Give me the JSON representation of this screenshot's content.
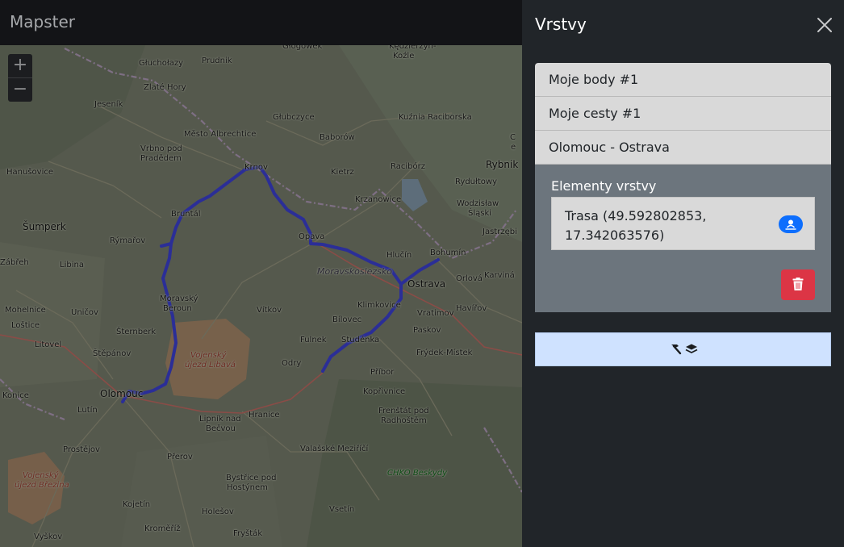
{
  "app": {
    "brand": "Mapster"
  },
  "map": {
    "zoom_in_label": "+",
    "zoom_out_label": "−",
    "route_color": "#2b2e97",
    "labels": {
      "prudnik": "Prudnik",
      "glogowek": "Głogówek",
      "kedzierzyn": "Kędzierzyn-",
      "kozle": "Koźle",
      "glucholazy": "Głuchołazy",
      "zlate_hory": "Zlaté Hory",
      "jesenik": "Jeseník",
      "glubczyce": "Głubczyce",
      "kuznia": "Kuźnia Raciborska",
      "mesto_albrechtice": "Město Albrechtice",
      "baborow": "Baborów",
      "vrbno_1": "Vrbno pod",
      "vrbno_2": "Pradědem",
      "krnov": "Krnov",
      "kietrz": "Kietrz",
      "raciborz": "Racibórz",
      "rydultowy": "Rydułtowy",
      "rybnik": "Rybnik",
      "hanusovice": "Hanušovice",
      "bruntal": "Bruntál",
      "krzanowice": "Krzanowice",
      "wodzislaw_1": "Wodzisław",
      "wodzislaw_2": "Śląski",
      "sumperk": "Šumperk",
      "rymarov": "Rýmařov",
      "opava": "Opava",
      "jastrzebie": "Jastrzębi",
      "bohumin": "Bohumín",
      "zabreh": "Zábřeh",
      "libina": "Libina",
      "hlucin": "Hlučín",
      "moravskoslezsko": "Moravskoslezsko",
      "orlova": "Orlová",
      "karvina": "Karviná",
      "ostrava": "Ostrava",
      "moravsky_beroun_1": "Moravský",
      "moravsky_beroun_2": "Beroun",
      "mohelnice": "Mohelnice",
      "unicov": "Uničov",
      "vitkov": "Vítkov",
      "klimkovice": "Klimkovice",
      "vratimov": "Vratimov",
      "havirov": "Havířov",
      "losice": "Loštice",
      "bilovec": "Bílovec",
      "sternberk": "Šternberk",
      "paskov": "Paskov",
      "litovel": "Litovel",
      "fulnek": "Fulnek",
      "studenka": "Studénka",
      "frydek": "Frýdek-Místek",
      "vojensky_libava_1": "Vojenský",
      "vojensky_libava_2": "újezd Libavá",
      "stepanov": "Štěpánov",
      "odry": "Odry",
      "pribor": "Příbor",
      "olomouc": "Olomouc",
      "konice": "Konice",
      "koprivnice": "Kopřivnice",
      "lutin": "Lutín",
      "hranice": "Hranice",
      "frenstat_1": "Frenštát pod",
      "frenstat_2": "Radhoštěm",
      "lipnik_1": "Lipník nad",
      "lipnik_2": "Bečvou",
      "prostejov": "Prostějov",
      "valasske": "Valašské Meziříčí",
      "prerov": "Přerov",
      "chko": "CHKO Beskydy",
      "vojensky_brezina_1": "Vojenský",
      "vojensky_brezina_2": "újezd Březina",
      "bystrice_1": "Bystřice pod",
      "bystrice_2": "Hostýnem",
      "kojetin": "Kojetín",
      "holesov": "Holešov",
      "vsetin": "Vsetín",
      "kromeriz": "Kroměříž",
      "frystak": "Fryšták",
      "vyskov": "Vyškov",
      "c_edge": "C",
      "e_edge": "e"
    }
  },
  "panel": {
    "title": "Vrstvy",
    "layers": [
      {
        "label": "Moje body #1"
      },
      {
        "label": "Moje cesty #1"
      },
      {
        "label": "Olomouc - Ostrava"
      }
    ],
    "detail": {
      "title": "Elementy vrstvy",
      "element_text": "Trasa (49.592802853, 17.342063576)"
    },
    "colors": {
      "delete": "#dc3545",
      "badge": "#0d6efd",
      "tool": "#cfe2ff"
    }
  }
}
